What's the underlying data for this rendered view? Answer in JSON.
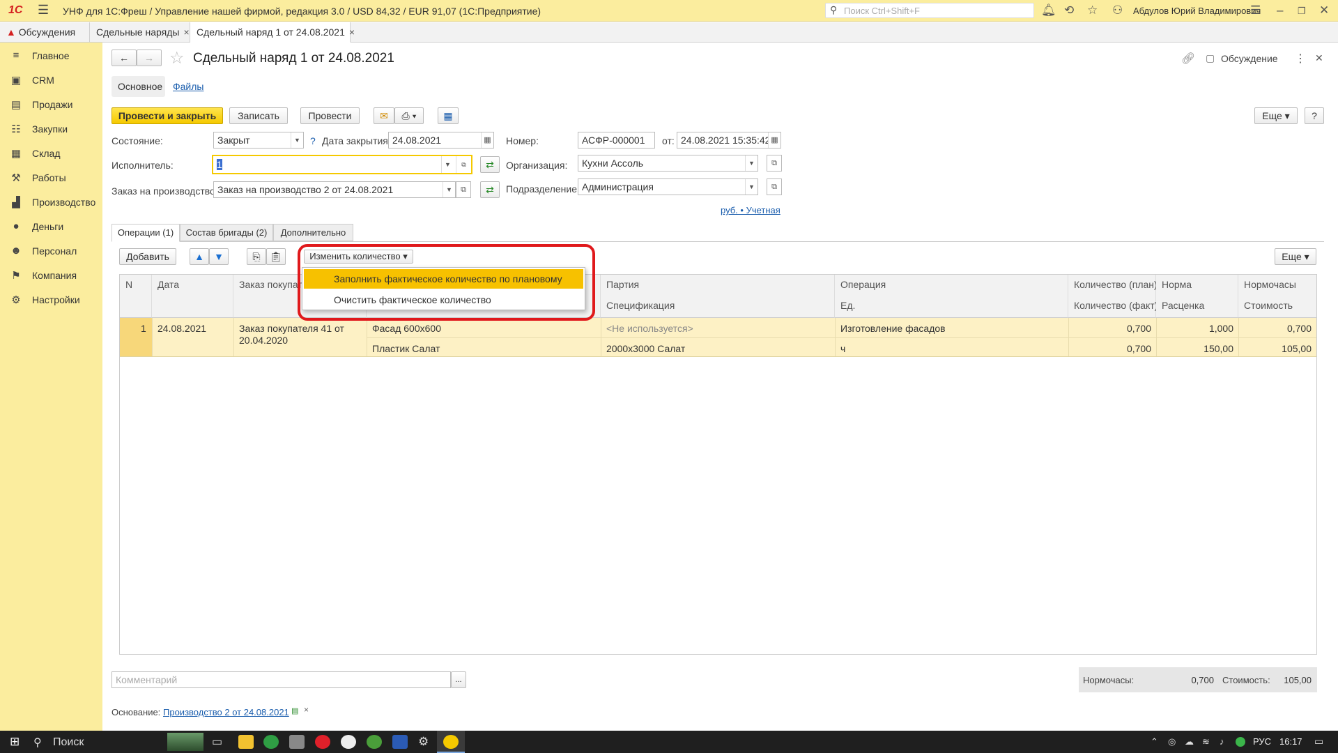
{
  "titlebar": {
    "logo": "1С",
    "title": "УНФ для 1С:Фреш / Управление нашей фирмой, редакция 3.0 / USD 84,32 / EUR 91,07  (1С:Предприятие)",
    "search_placeholder": "Поиск Ctrl+Shift+F",
    "user": "Абдулов Юрий Владимирович"
  },
  "tabs": [
    {
      "label": "Обсуждения"
    },
    {
      "label": "Сдельные наряды",
      "close": "×"
    },
    {
      "label": "Сдельный наряд 1 от 24.08.2021",
      "close": "×"
    }
  ],
  "sidebar": {
    "items": [
      {
        "label": "Главное",
        "icon": "menu-icon"
      },
      {
        "label": "CRM",
        "icon": "crm-icon"
      },
      {
        "label": "Продажи",
        "icon": "cart-icon"
      },
      {
        "label": "Закупки",
        "icon": "purchase-icon"
      },
      {
        "label": "Склад",
        "icon": "warehouse-icon"
      },
      {
        "label": "Работы",
        "icon": "tools-icon"
      },
      {
        "label": "Производство",
        "icon": "factory-icon"
      },
      {
        "label": "Деньги",
        "icon": "money-icon"
      },
      {
        "label": "Персонал",
        "icon": "people-icon"
      },
      {
        "label": "Компания",
        "icon": "flag-icon"
      },
      {
        "label": "Настройки",
        "icon": "gear-icon"
      }
    ]
  },
  "doc": {
    "title": "Сдельный наряд 1 от 24.08.2021",
    "discussion": "Обсуждение",
    "tab_main": "Основное",
    "tab_files": "Файлы"
  },
  "toolbar": {
    "post_close": "Провести и закрыть",
    "save": "Записать",
    "post": "Провести",
    "more": "Еще",
    "help": "?"
  },
  "form": {
    "state_label": "Состояние:",
    "state_value": "Закрыт",
    "help_mark": "?",
    "close_date_label": "Дата закрытия:",
    "close_date_value": "24.08.2021",
    "number_label": "Номер:",
    "number_value": "АСФР-000001",
    "from_label": "от:",
    "from_value": "24.08.2021 15:35:42",
    "executor_label": "Исполнитель:",
    "executor_value": "1",
    "org_label": "Организация:",
    "org_value": "Кухни Ассоль",
    "order_label": "Заказ на производство:",
    "order_value": "Заказ на производство 2 от 24.08.2021",
    "dept_label": "Подразделение:",
    "dept_value": "Администрация",
    "currency_link": "руб. • Учетная"
  },
  "inner_tabs": [
    "Операции (1)",
    "Состав бригады (2)",
    "Дополнительно"
  ],
  "grid_toolbar": {
    "add": "Добавить",
    "change_qty": "Изменить количество",
    "more": "Еще"
  },
  "menu": {
    "items": [
      "Заполнить фактическое количество по плановому",
      "Очистить фактическое количество"
    ]
  },
  "grid": {
    "headers": [
      {
        "t1": "N",
        "t2": ""
      },
      {
        "t1": "Дата",
        "t2": ""
      },
      {
        "t1": "Заказ покупателя",
        "t2": ""
      },
      {
        "t1": "",
        "t2": ""
      },
      {
        "t1": "Партия",
        "t2": "Спецификация"
      },
      {
        "t1": "Операция",
        "t2": "Ед."
      },
      {
        "t1": "Количество (план)",
        "t2": "Количество (факт)"
      },
      {
        "t1": "Норма",
        "t2": "Расценка"
      },
      {
        "t1": "Нормочасы",
        "t2": "Стоимость"
      }
    ],
    "row": {
      "n": "1",
      "date": "24.08.2021",
      "order_l1": "Заказ покупателя 41 от",
      "order_l2": "20.04.2020",
      "product": "Фасад 600х600",
      "characteristic": "Пластик Салат",
      "batch": "<Не используется>",
      "spec": "2000х3000 Салат",
      "operation": "Изготовление фасадов",
      "unit": "ч",
      "qty_plan": "0,700",
      "qty_fact": "0,700",
      "norm": "1,000",
      "rate": "150,00",
      "hours": "0,700",
      "cost": "105,00"
    }
  },
  "footer": {
    "comment_placeholder": "Комментарий",
    "ellipsis": "...",
    "hours_label": "Нормочасы:",
    "hours_value": "0,700",
    "cost_label": "Стоимость:",
    "cost_value": "105,00",
    "basis_label": "Основание:",
    "basis_link": "Производство 2 от 24.08.2021",
    "basis_close": "×"
  },
  "taskbar": {
    "search": "Поиск",
    "lang": "РУС",
    "time": "16:17"
  }
}
